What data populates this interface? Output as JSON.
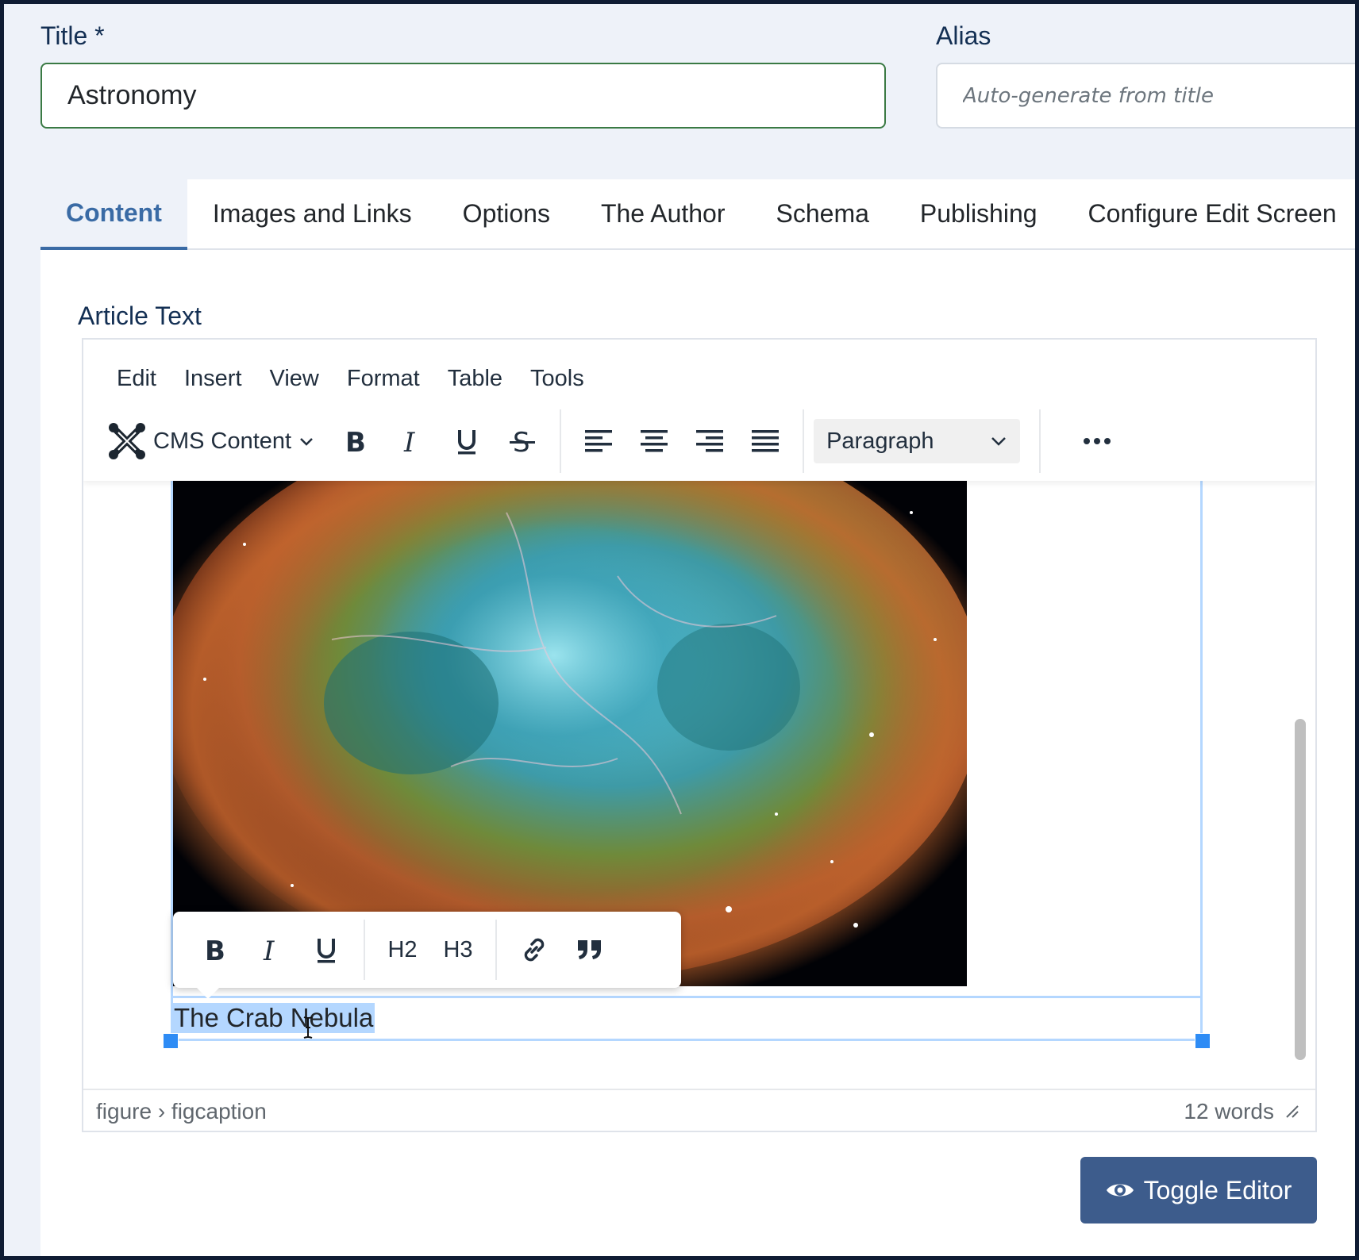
{
  "form": {
    "title_label": "Title *",
    "title_value": "Astronomy",
    "alias_label": "Alias",
    "alias_placeholder": "Auto-generate from title"
  },
  "tabs": [
    {
      "label": "Content",
      "active": true
    },
    {
      "label": "Images and Links"
    },
    {
      "label": "Options"
    },
    {
      "label": "The Author"
    },
    {
      "label": "Schema"
    },
    {
      "label": "Publishing"
    },
    {
      "label": "Configure Edit Screen"
    }
  ],
  "editor": {
    "label": "Article Text",
    "menu": [
      "Edit",
      "Insert",
      "View",
      "Format",
      "Table",
      "Tools"
    ],
    "cms_content_label": "CMS Content",
    "block_format": "Paragraph",
    "quickbar": {
      "h2": "H2",
      "h3": "H3"
    },
    "caption": "The Crab Nebula",
    "statusbar": {
      "path": "figure › figcaption",
      "word_count": "12 words"
    }
  },
  "toggle_editor_label": "Toggle Editor",
  "colors": {
    "accent": "#3a6ba5",
    "button": "#3d5c8c",
    "selection": "#b4d7ff",
    "handle": "#2e8cf5"
  }
}
